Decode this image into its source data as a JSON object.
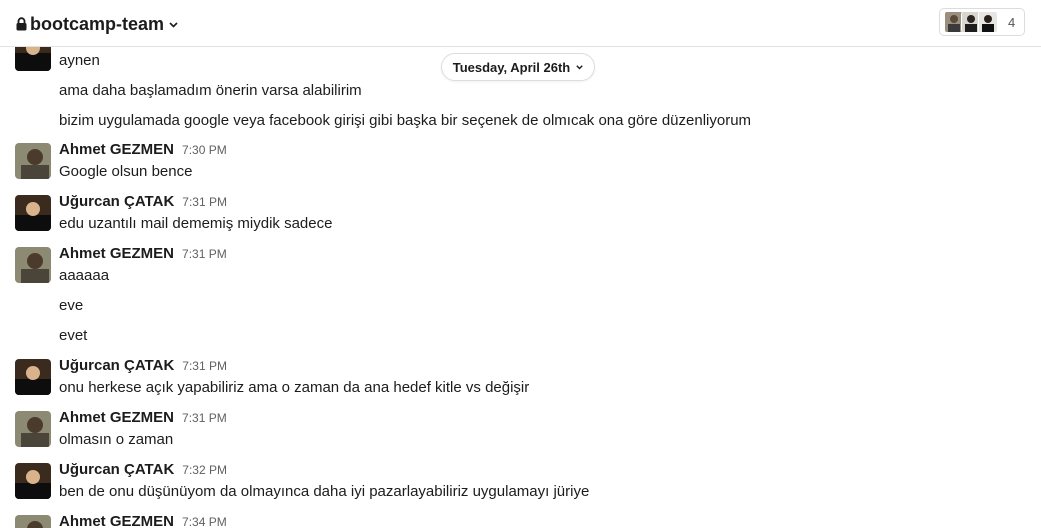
{
  "header": {
    "channel_name": "bootcamp-team",
    "member_count": "4",
    "icons": {
      "lock": "lock-icon",
      "chevron": "chevron-down-icon"
    }
  },
  "date_divider": {
    "label": "Tuesday, April 26th"
  },
  "messages": [
    {
      "text": "aynen"
    },
    {
      "text": "ama daha başlamadım önerin varsa alabilirim"
    },
    {
      "text": "bizim uygulamada google veya facebook girişi gibi başka bir seçenek de olmıcak ona göre düzenliyorum"
    },
    {
      "author": "Ahmet GEZMEN",
      "time": "7:30 PM",
      "text": "Google olsun bence"
    },
    {
      "author": "Uğurcan ÇATAK",
      "time": "7:31 PM",
      "text": "edu uzantılı mail dememiş miydik sadece"
    },
    {
      "author": "Ahmet GEZMEN",
      "time": "7:31 PM",
      "text": "aaaaaa"
    },
    {
      "text": "eve"
    },
    {
      "text": "evet"
    },
    {
      "author": "Uğurcan ÇATAK",
      "time": "7:31 PM",
      "text": "onu herkese açık yapabiliriz ama o zaman da ana hedef kitle vs değişir"
    },
    {
      "author": "Ahmet GEZMEN",
      "time": "7:31 PM",
      "text": "olmasın o zaman"
    },
    {
      "author": "Uğurcan ÇATAK",
      "time": "7:32 PM",
      "text": "ben de onu düşünüyom da olmayınca daha iyi pazarlayabiliriz uygulamayı jüriye"
    },
    {
      "author": "Ahmet GEZMEN",
      "time": "7:34 PM"
    }
  ],
  "colors": {
    "text": "#1d1c1d",
    "muted": "#616061",
    "border": "#e2e2e2"
  }
}
